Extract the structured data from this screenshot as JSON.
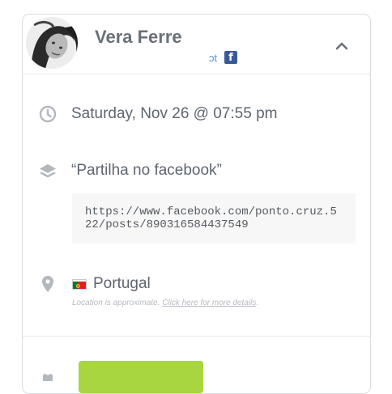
{
  "profile": {
    "name": "Vera Ferre",
    "subtitle_fragment": "ɔt",
    "fb_icon_glyph": "f"
  },
  "post": {
    "datetime": "Saturday, Nov 26 @ 07:55 pm",
    "title": "“Partilha no facebook”",
    "url": "https://www.facebook.com/ponto.cruz.522/posts/890316584437549"
  },
  "location": {
    "country": "Portugal",
    "note_prefix": "Location is approximate.",
    "note_link": "Click here for more details",
    "note_suffix": "."
  },
  "colors": {
    "accent_green": "#a7d63e",
    "facebook_blue": "#3b5998",
    "icon_gray": "#b3b8be"
  }
}
